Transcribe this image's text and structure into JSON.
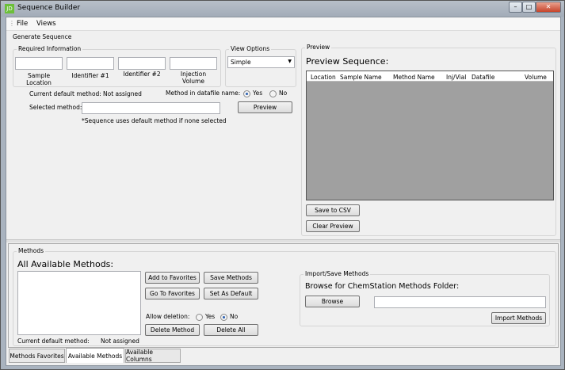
{
  "window": {
    "title": "Sequence Builder",
    "icon_text": "JD"
  },
  "menu": [
    "File",
    "Views"
  ],
  "generate": {
    "title": "Generate Sequence",
    "required_info": "Required Information",
    "fields": [
      "Sample Location",
      "Identifier #1",
      "Identifier #2",
      "Injection Volume"
    ],
    "view_options": "View Options",
    "view_selected": "Simple",
    "current_default_label": "Current default method:",
    "current_default_value": "Not assigned",
    "method_in_datafile": "Method in datafile name:",
    "yes": "Yes",
    "no": "No",
    "selected_method": "Selected method:*",
    "selected_method_value": "",
    "preview_btn": "Preview",
    "note": "*Sequence uses default method if none selected"
  },
  "preview": {
    "group": "Preview",
    "title": "Preview Sequence:",
    "columns": [
      "Location",
      "Sample Name",
      "Method Name",
      "Inj/Vial",
      "Datafile",
      "Volume"
    ],
    "save_csv": "Save to CSV",
    "clear": "Clear Preview"
  },
  "methods": {
    "group": "Methods",
    "title": "All Available Methods:",
    "add_fav": "Add to Favorites",
    "save": "Save Methods",
    "go_fav": "Go To Favorites",
    "set_default": "Set As Default",
    "allow_deletion": "Allow deletion:",
    "yes": "Yes",
    "no": "No",
    "delete_method": "Delete Method",
    "delete_all": "Delete All",
    "current_default_label": "Current default method:",
    "current_default_value": "Not assigned",
    "import_group": "Import/Save Methods",
    "browse_label": "Browse for ChemStation Methods Folder:",
    "browse": "Browse",
    "folder_value": "",
    "import": "Import Methods"
  },
  "tabs": [
    {
      "label": "Methods Favorites"
    },
    {
      "label": "Available Methods",
      "selected": true
    },
    {
      "label": "Available Columns"
    }
  ]
}
